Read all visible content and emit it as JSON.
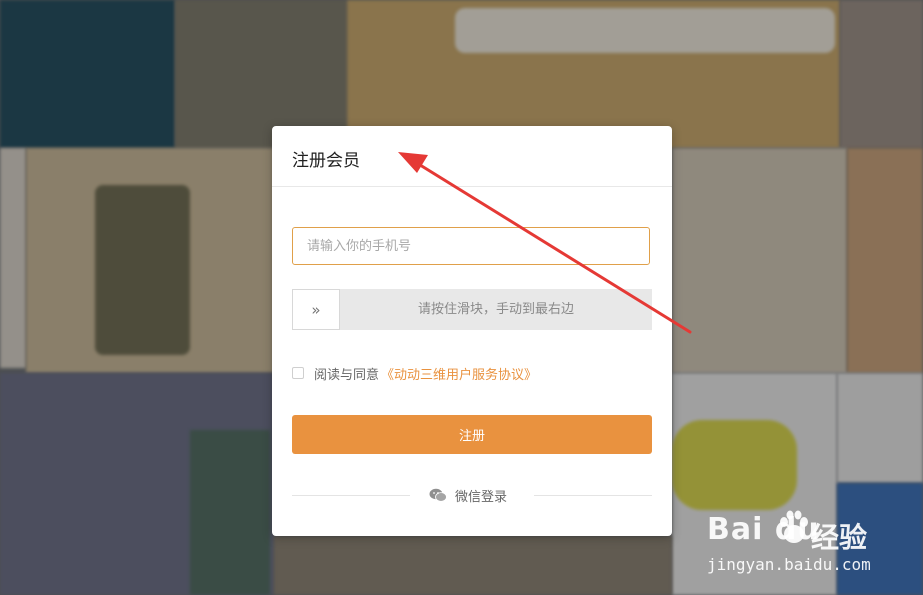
{
  "modal": {
    "title": "注册会员",
    "phone_placeholder": "请输入你的手机号",
    "slider_handle_glyph": "»",
    "slider_text": "请按住滑块，手动到最右边",
    "agree_text": "阅读与同意",
    "agree_link": "《动动三维用户服务协议》",
    "register_label": "注册",
    "wechat_label": "微信登录"
  },
  "watermark": {
    "brand": "Bai du",
    "brand_cn": "经验",
    "url": "jingyan.baidu.com"
  },
  "colors": {
    "accent": "#e9923f",
    "annotation_arrow": "#e53935"
  },
  "icons": [
    "slider-arrows-icon",
    "wechat-icon",
    "baidu-paw-icon"
  ]
}
